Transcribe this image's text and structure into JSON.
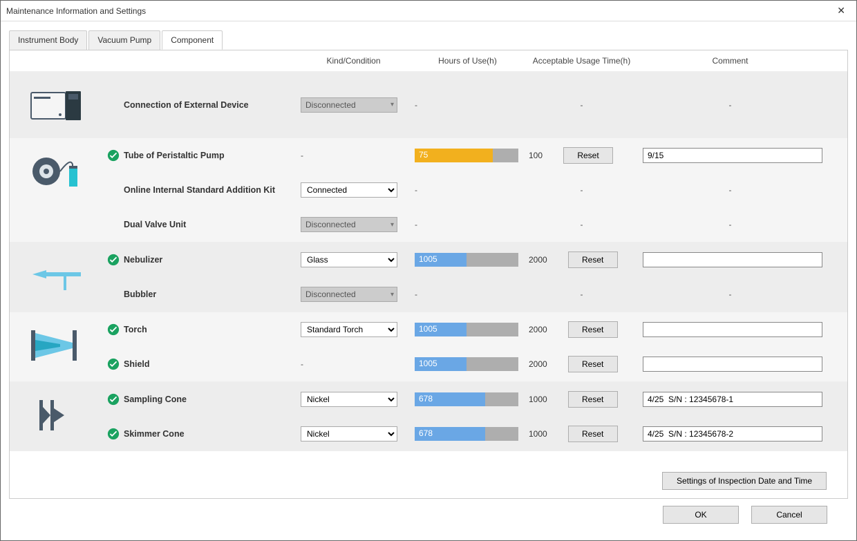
{
  "window": {
    "title": "Maintenance Information and Settings"
  },
  "tabs": [
    {
      "label": "Instrument Body"
    },
    {
      "label": "Vacuum Pump"
    },
    {
      "label": "Component"
    }
  ],
  "headers": {
    "kind": "Kind/Condition",
    "hours": "Hours of Use(h)",
    "acceptable": "Acceptable Usage Time(h)",
    "comment": "Comment"
  },
  "buttons": {
    "reset": "Reset",
    "settings": "Settings of Inspection Date and Time",
    "ok": "OK",
    "cancel": "Cancel"
  },
  "rows": {
    "connExt": {
      "label": "Connection of External Device",
      "kind": "Disconnected"
    },
    "tubePump": {
      "label": "Tube of Peristaltic Pump",
      "hours": 75,
      "acceptable": 100,
      "comment": "9/15"
    },
    "onlineKit": {
      "label": "Online Internal Standard Addition Kit",
      "kind": "Connected"
    },
    "dualValve": {
      "label": "Dual Valve Unit",
      "kind": "Disconnected"
    },
    "nebulizer": {
      "label": "Nebulizer",
      "kind": "Glass",
      "hours": 1005,
      "acceptable": 2000,
      "comment": ""
    },
    "bubbler": {
      "label": "Bubbler",
      "kind": "Disconnected"
    },
    "torch": {
      "label": "Torch",
      "kind": "Standard Torch",
      "hours": 1005,
      "acceptable": 2000,
      "comment": ""
    },
    "shield": {
      "label": "Shield",
      "hours": 1005,
      "acceptable": 2000,
      "comment": ""
    },
    "sampling": {
      "label": "Sampling Cone",
      "kind": "Nickel",
      "hours": 678,
      "acceptable": 1000,
      "comment": "4/25  S/N : 12345678-1"
    },
    "skimmer": {
      "label": "Skimmer Cone",
      "kind": "Nickel",
      "hours": 678,
      "acceptable": 1000,
      "comment": "4/25  S/N : 12345678-2"
    }
  }
}
